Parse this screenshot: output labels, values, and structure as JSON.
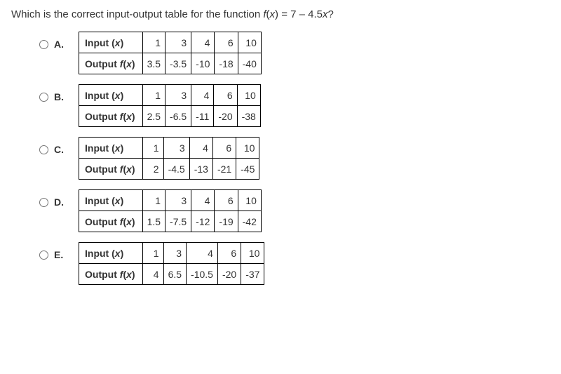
{
  "question_prefix": "Which is the correct input-output table for the function ",
  "question_fn": "f",
  "question_paren": "(",
  "question_var": "x",
  "question_suffix": ") = 7 – 4.5",
  "question_end": "?",
  "row_input_label": "Input (x)",
  "row_output_label_f": "Output f",
  "row_output_label_x": "(x)",
  "options": {
    "A": {
      "label": "A.",
      "inputs": [
        "1",
        "3",
        "4",
        "6",
        "10"
      ],
      "outputs": [
        "3.5",
        "-3.5",
        "-10",
        "-18",
        "-40"
      ]
    },
    "B": {
      "label": "B.",
      "inputs": [
        "1",
        "3",
        "4",
        "6",
        "10"
      ],
      "outputs": [
        "2.5",
        "-6.5",
        "-11",
        "-20",
        "-38"
      ]
    },
    "C": {
      "label": "C.",
      "inputs": [
        "1",
        "3",
        "4",
        "6",
        "10"
      ],
      "outputs": [
        "2",
        "-4.5",
        "-13",
        "-21",
        "-45"
      ]
    },
    "D": {
      "label": "D.",
      "inputs": [
        "1",
        "3",
        "4",
        "6",
        "10"
      ],
      "outputs": [
        "1.5",
        "-7.5",
        "-12",
        "-19",
        "-42"
      ]
    },
    "E": {
      "label": "E.",
      "inputs": [
        "1",
        "3",
        "4",
        "6",
        "10"
      ],
      "outputs": [
        "4",
        "6.5",
        "-10.5",
        "-20",
        "-37"
      ]
    }
  }
}
